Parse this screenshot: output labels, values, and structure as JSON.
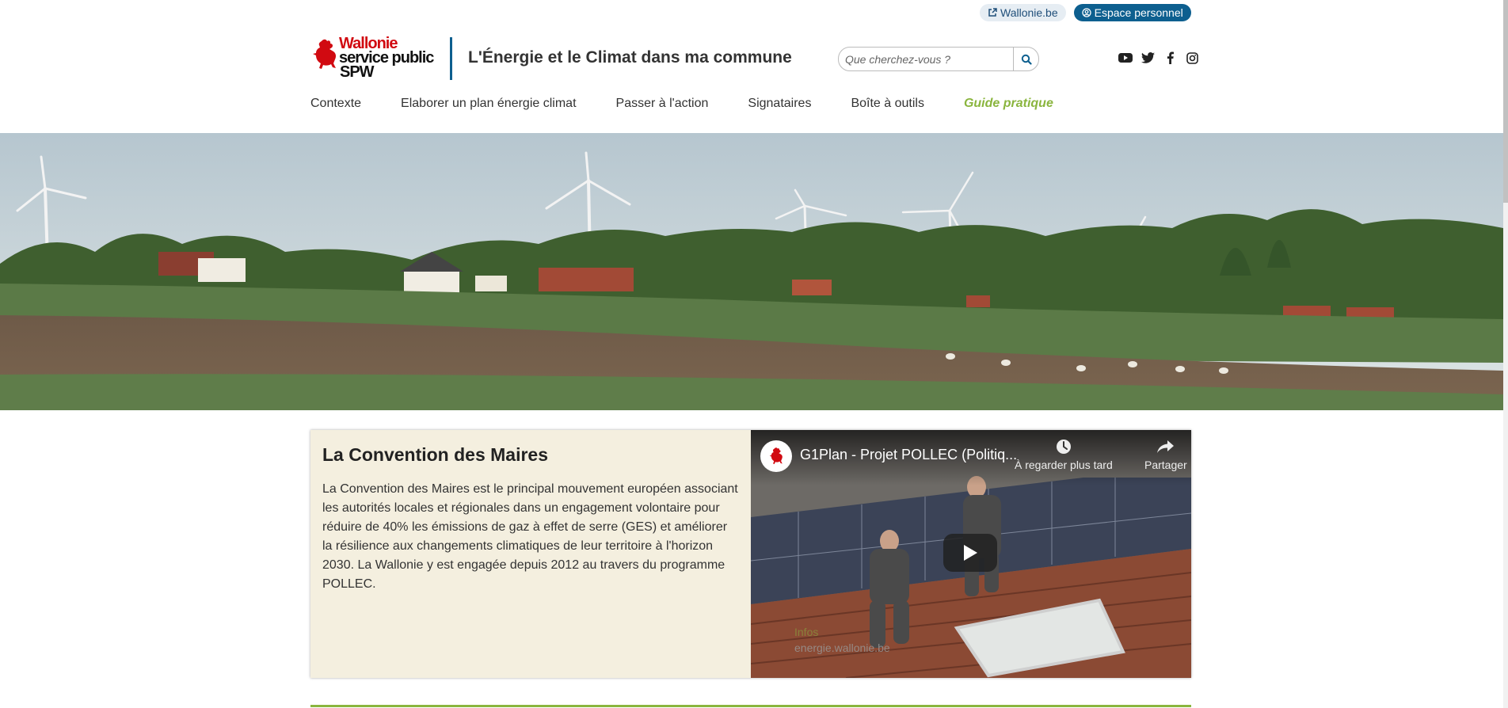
{
  "topbar": {
    "wallonie_link": "Wallonie.be",
    "espace_button": "Espace personnel"
  },
  "header": {
    "logo_line1": "Wallonie",
    "logo_line2": "service public",
    "logo_line3": "SPW",
    "site_title": "L'Énergie et le Climat dans ma commune",
    "search_placeholder": "Que cherchez-vous ?"
  },
  "socials": [
    "youtube-icon",
    "twitter-icon",
    "facebook-icon",
    "instagram-icon"
  ],
  "nav": {
    "items": [
      {
        "label": "Contexte"
      },
      {
        "label": "Elaborer un plan énergie climat"
      },
      {
        "label": "Passer à l'action"
      },
      {
        "label": "Signataires"
      },
      {
        "label": "Boîte à outils"
      },
      {
        "label": "Guide pratique"
      }
    ]
  },
  "content": {
    "title": "La Convention des Maires",
    "body": "La Convention des Maires est le principal mouvement européen associant les autorités locales et régionales dans un engagement volontaire pour réduire de 40% les émissions de gaz à effet de serre (GES) et améliorer la résilience aux changements climatiques de leur territoire à l'horizon 2030. La Wallonie y est engagée depuis 2012 au travers du programme POLLEC."
  },
  "video": {
    "title": "G1Plan - Projet POLLEC (Politiq...",
    "watch_later": "À regarder plus tard",
    "share": "Partager",
    "watermark_line1": "Infos",
    "watermark_line2": "energie.wallonie.be"
  },
  "colors": {
    "brand_red": "#d10a11",
    "brand_blue": "#0d5f8f",
    "accent_green": "#8ab53e",
    "card_bg": "#f4efdf"
  }
}
